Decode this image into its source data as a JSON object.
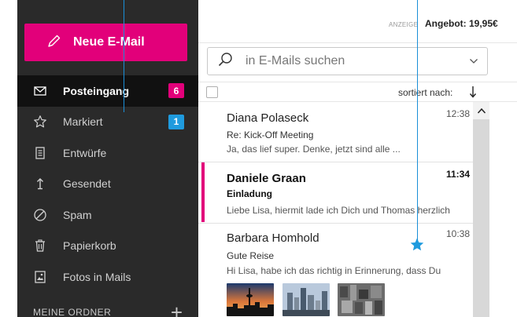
{
  "compose": {
    "label": "Neue E-Mail"
  },
  "nav": {
    "inbox": {
      "label": "Posteingang",
      "badge": "6"
    },
    "starred": {
      "label": "Markiert",
      "badge": "1"
    },
    "drafts": {
      "label": "Entwürfe"
    },
    "sent": {
      "label": "Gesendet"
    },
    "spam": {
      "label": "Spam"
    },
    "trash": {
      "label": "Papierkorb"
    },
    "photos": {
      "label": "Fotos in Mails"
    }
  },
  "folders": {
    "heading": "MEINE ORDNER"
  },
  "ad": {
    "tag": "ANZEIGE",
    "offer": "Angebot: 19,95€"
  },
  "search": {
    "placeholder": "in E-Mails suchen"
  },
  "sort": {
    "label": "sortiert nach:"
  },
  "mails": [
    {
      "from": "Diana Polaseck",
      "subject": "Re: Kick-Off Meeting",
      "preview": "Ja, das lief super. Denke, jetzt sind alle ...",
      "time": "12:38",
      "unread": false
    },
    {
      "from": "Daniele Graan",
      "subject": "Einladung",
      "preview": "Liebe Lisa, hiermit lade ich Dich und Thomas herzlich",
      "time": "11:34",
      "unread": true
    },
    {
      "from": "Barbara Homhold",
      "subject": "Gute Reise",
      "preview": "Hi Lisa, habe ich das richtig in Erinnerung, dass Du",
      "time": "10:38",
      "unread": false
    }
  ],
  "colors": {
    "brand": "#e2007a",
    "accent": "#1f9bde",
    "sidebar": "#2a2a2a"
  },
  "icons": {
    "compose": "pencil-icon",
    "inbox": "envelope-icon",
    "starred": "star-outline-icon",
    "drafts": "document-icon",
    "sent": "upload-arrow-icon",
    "spam": "blocked-icon",
    "trash": "trash-icon",
    "photos": "photo-icon",
    "search": "search-icon",
    "dropdown": "chevron-down-icon",
    "sort": "arrow-down-icon",
    "scroll": "chevron-up-icon",
    "favorite": "star-filled-icon"
  }
}
